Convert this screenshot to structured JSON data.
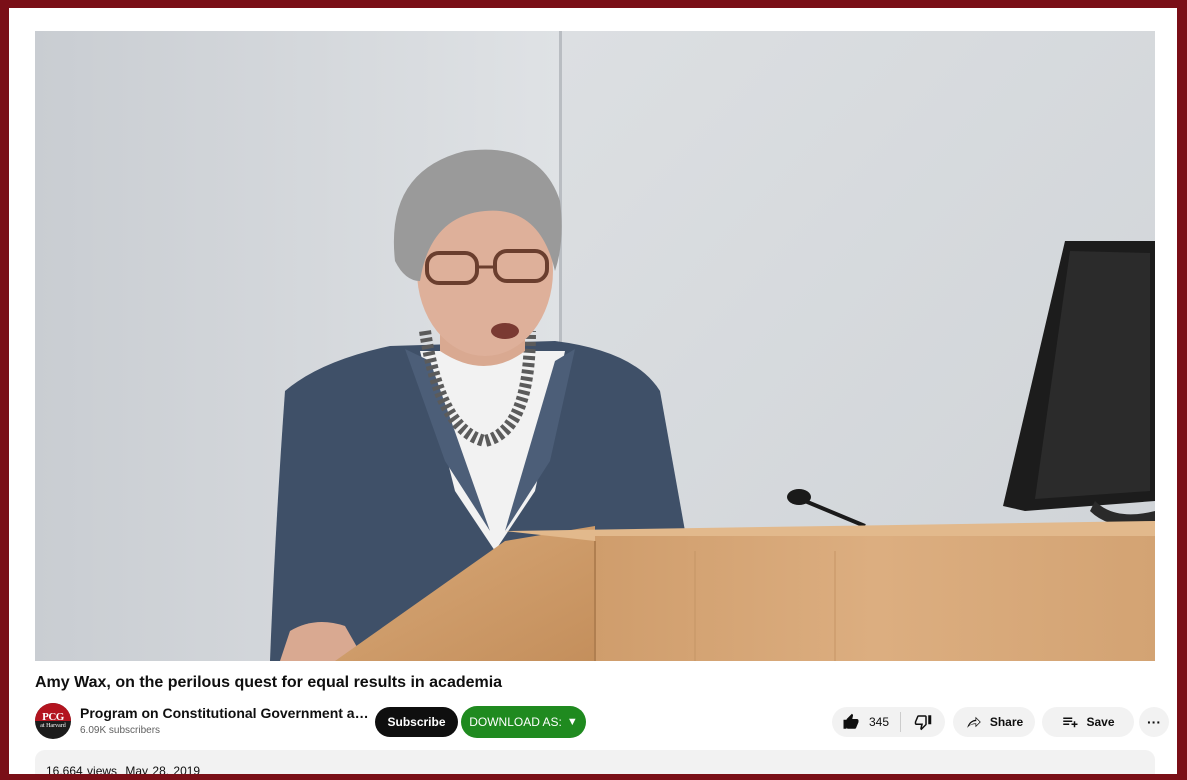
{
  "video": {
    "title": "Amy Wax, on the perilous quest for equal results in academia"
  },
  "channel": {
    "avatar_logo": "PCG",
    "avatar_sub": "at Harvard",
    "name": "Program on Constitutional Government at Harvard",
    "subscribers": "6.09K subscribers",
    "brand_color": "#b3141f"
  },
  "actions": {
    "subscribe_label": "Subscribe",
    "download_label": "DOWNLOAD AS:",
    "download_arrow": "▼",
    "download_color": "#1f8a1f",
    "like_icon": "thumbs-up-icon",
    "like_count": "345",
    "dislike_icon": "thumbs-down-icon",
    "share_icon": "share-arrow-icon",
    "share_label": "Share",
    "save_icon": "playlist-add-icon",
    "save_label": "Save",
    "more_label": "···"
  },
  "description": {
    "views": "16,664 views",
    "date": "May 28, 2019"
  }
}
